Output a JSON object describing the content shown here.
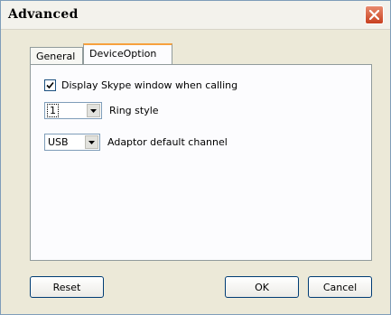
{
  "window": {
    "title": "Advanced",
    "close_icon": "close-icon"
  },
  "tabs": [
    {
      "label": "General",
      "active": false
    },
    {
      "label": "DeviceOption",
      "active": true
    }
  ],
  "options": {
    "display_skype": {
      "label": "Display Skype window when calling",
      "checked": true
    },
    "ring_style": {
      "value": "1",
      "label": "Ring style"
    },
    "adaptor_channel": {
      "value": "USB",
      "label": "Adaptor default channel"
    }
  },
  "buttons": {
    "reset": "Reset",
    "ok": "OK",
    "cancel": "Cancel"
  }
}
